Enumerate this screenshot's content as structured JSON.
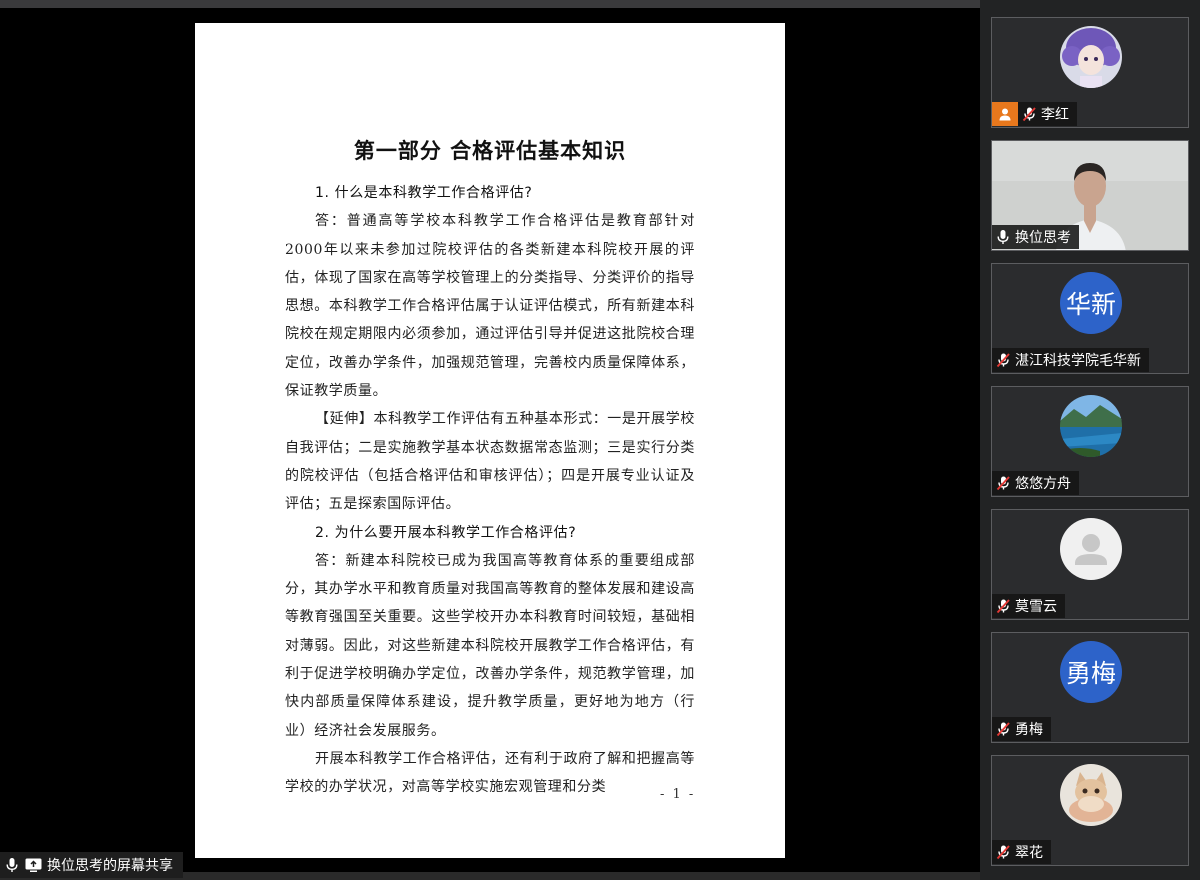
{
  "screen_share": {
    "label": "换位思考的屏幕共享",
    "document": {
      "title": "第一部分  合格评估基本知识",
      "paragraphs": [
        {
          "type": "question",
          "text": "1. 什么是本科教学工作合格评估?"
        },
        {
          "type": "answer",
          "text": "答：普通高等学校本科教学工作合格评估是教育部针对2000年以来未参加过院校评估的各类新建本科院校开展的评估，体现了国家在高等学校管理上的分类指导、分类评价的指导思想。本科教学工作合格评估属于认证评估模式，所有新建本科院校在规定期限内必须参加，通过评估引导并促进这批院校合理定位，改善办学条件，加强规范管理，完善校内质量保障体系，保证教学质量。"
        },
        {
          "type": "answer",
          "text": "【延伸】本科教学工作评估有五种基本形式：一是开展学校自我评估；二是实施教学基本状态数据常态监测；三是实行分类的院校评估（包括合格评估和审核评估）；四是开展专业认证及评估；五是探索国际评估。"
        },
        {
          "type": "question",
          "text": "2. 为什么要开展本科教学工作合格评估?"
        },
        {
          "type": "answer",
          "text": "答：新建本科院校已成为我国高等教育体系的重要组成部分，其办学水平和教育质量对我国高等教育的整体发展和建设高等教育强国至关重要。这些学校开办本科教育时间较短，基础相对薄弱。因此，对这些新建本科院校开展教学工作合格评估，有利于促进学校明确办学定位，改善办学条件，规范教学管理，加快内部质量保障体系建设，提升教学质量，更好地为地方（行业）经济社会发展服务。"
        },
        {
          "type": "answer",
          "text": "开展本科教学工作合格评估，还有利于政府了解和把握高等学校的办学状况，对高等学校实施宏观管理和分类"
        }
      ],
      "page_number": "- 1 -"
    }
  },
  "participants": [
    {
      "name": "李红",
      "avatar_kind": "photo-anime",
      "mic": "muted",
      "host": true
    },
    {
      "name": "换位思考",
      "avatar_kind": "video",
      "mic": "on",
      "host": false
    },
    {
      "name": "湛江科技学院毛华新",
      "avatar_kind": "text",
      "avatar_text": "华新",
      "mic": "muted",
      "host": false
    },
    {
      "name": "悠悠方舟",
      "avatar_kind": "photo-lake",
      "mic": "muted",
      "host": false
    },
    {
      "name": "莫雪云",
      "avatar_kind": "default",
      "mic": "muted",
      "host": false
    },
    {
      "name": "勇梅",
      "avatar_kind": "text",
      "avatar_text": "勇梅",
      "mic": "muted",
      "host": false
    },
    {
      "name": "翠花",
      "avatar_kind": "photo-kitten",
      "mic": "muted",
      "host": false
    }
  ],
  "colors": {
    "host_badge": "#e8781d",
    "text_avatar_bg": "#2d63c9",
    "tile_bg": "#2b2c2e",
    "muted_slash": "#e53935"
  }
}
